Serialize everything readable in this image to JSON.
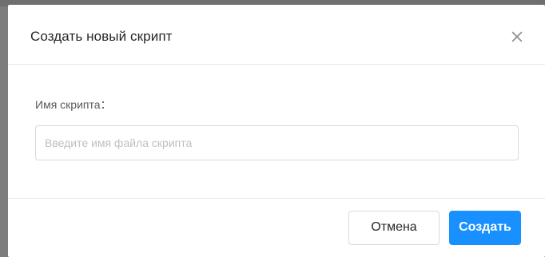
{
  "dialog": {
    "title": "Создать новый скрипт",
    "close_icon": "close-icon",
    "field_label": "Имя скрипта：",
    "input": {
      "value": "",
      "placeholder": "Введите имя файла скрипта"
    },
    "cancel_label": "Отмена",
    "create_label": "Создать"
  },
  "colors": {
    "primary": "#1890ff",
    "border": "#d9d9d9",
    "divider": "#e8e8e8"
  }
}
